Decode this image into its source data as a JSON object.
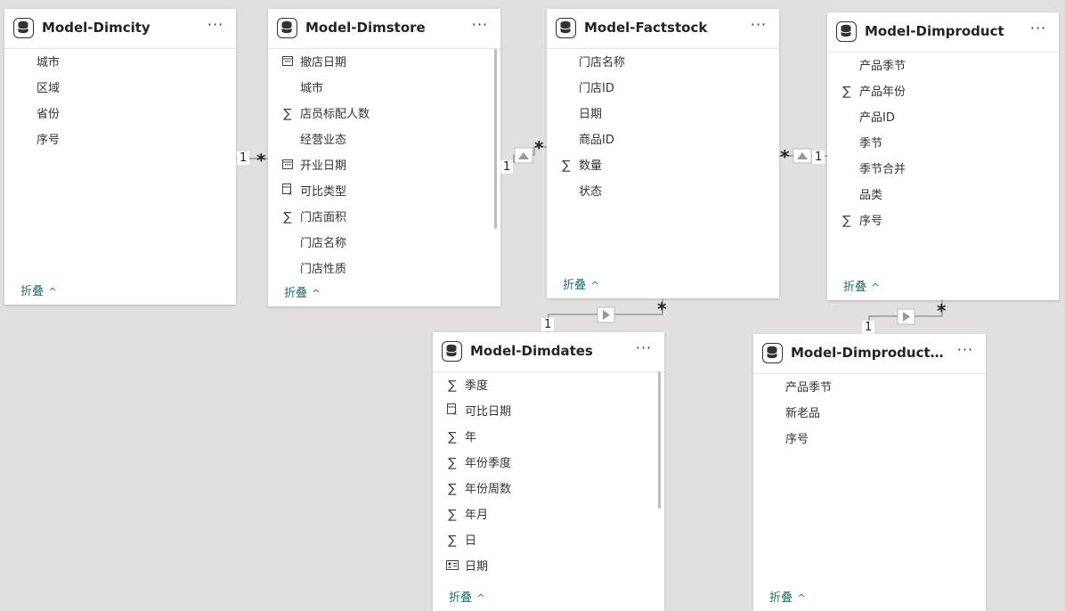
{
  "collapse_label": "折叠",
  "tables": {
    "dimcity": {
      "title": "Model-Dimcity",
      "fields": [
        {
          "label": "城市",
          "icon": ""
        },
        {
          "label": "区域",
          "icon": ""
        },
        {
          "label": "省份",
          "icon": ""
        },
        {
          "label": "序号",
          "icon": ""
        }
      ]
    },
    "dimstore": {
      "title": "Model-Dimstore",
      "fields": [
        {
          "label": "撤店日期",
          "icon": "calendar"
        },
        {
          "label": "城市",
          "icon": ""
        },
        {
          "label": "店员标配人数",
          "icon": "sigma"
        },
        {
          "label": "经营业态",
          "icon": ""
        },
        {
          "label": "开业日期",
          "icon": "calendar"
        },
        {
          "label": "可比类型",
          "icon": "calc-column"
        },
        {
          "label": "门店面积",
          "icon": "sigma"
        },
        {
          "label": "门店名称",
          "icon": ""
        },
        {
          "label": "门店性质",
          "icon": ""
        }
      ]
    },
    "factstock": {
      "title": "Model-Factstock",
      "fields": [
        {
          "label": "门店名称",
          "icon": ""
        },
        {
          "label": "门店ID",
          "icon": ""
        },
        {
          "label": "日期",
          "icon": ""
        },
        {
          "label": "商品ID",
          "icon": ""
        },
        {
          "label": "数量",
          "icon": "sigma"
        },
        {
          "label": "状态",
          "icon": ""
        }
      ]
    },
    "dimproduct": {
      "title": "Model-Dimproduct",
      "fields": [
        {
          "label": "产品季节",
          "icon": ""
        },
        {
          "label": "产品年份",
          "icon": "sigma"
        },
        {
          "label": "产品ID",
          "icon": ""
        },
        {
          "label": "季节",
          "icon": ""
        },
        {
          "label": "季节合并",
          "icon": ""
        },
        {
          "label": "品类",
          "icon": ""
        },
        {
          "label": "序号",
          "icon": "sigma"
        }
      ]
    },
    "dimdates": {
      "title": "Model-Dimdates",
      "fields": [
        {
          "label": "季度",
          "icon": "sigma"
        },
        {
          "label": "可比日期",
          "icon": "calc-column"
        },
        {
          "label": "年",
          "icon": "sigma"
        },
        {
          "label": "年份季度",
          "icon": "sigma"
        },
        {
          "label": "年份周数",
          "icon": "sigma"
        },
        {
          "label": "年月",
          "icon": "sigma"
        },
        {
          "label": "日",
          "icon": "sigma"
        },
        {
          "label": "日期",
          "icon": "id-card"
        }
      ]
    },
    "dimproductseason": {
      "title": "Model-Dimproductseas...",
      "fields": [
        {
          "label": "产品季节",
          "icon": ""
        },
        {
          "label": "新老品",
          "icon": ""
        },
        {
          "label": "序号",
          "icon": ""
        }
      ]
    }
  },
  "relationships": [
    {
      "one": "1",
      "many": "*"
    },
    {
      "one": "1",
      "many": "*"
    },
    {
      "one": "1",
      "many": "*"
    },
    {
      "one": "1",
      "many": "*"
    },
    {
      "one": "1",
      "many": "*"
    }
  ]
}
